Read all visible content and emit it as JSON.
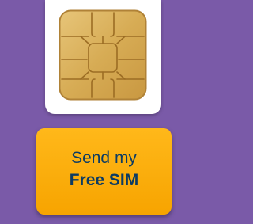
{
  "sim_card": {
    "chip_icon": "sim-chip-icon"
  },
  "cta": {
    "line1": "Send my",
    "line2": "Free SIM"
  }
}
